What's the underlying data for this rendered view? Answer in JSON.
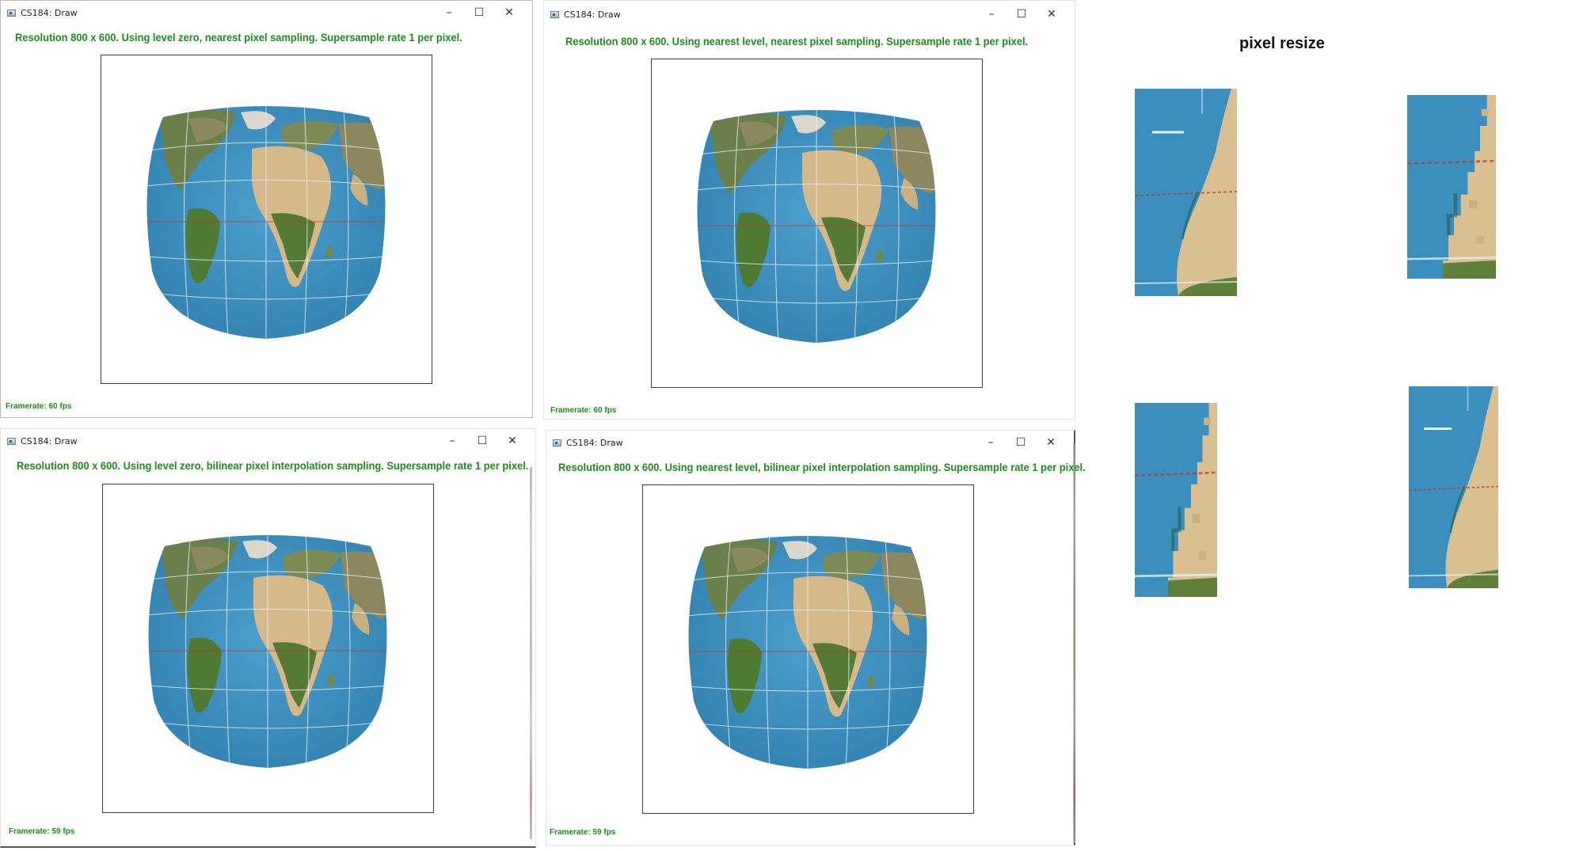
{
  "windows": [
    {
      "title": "CS184: Draw",
      "status": "Resolution 800 x 600. Using level zero, nearest pixel sampling. Supersample rate 1 per pixel.",
      "framerate": "Framerate: 60 fps"
    },
    {
      "title": "CS184: Draw",
      "status": "Resolution 800 x 600. Using nearest level, nearest pixel sampling. Supersample rate 1 per pixel.",
      "framerate": "Framerate: 60 fps"
    },
    {
      "title": "CS184: Draw",
      "status": "Resolution 800 x 600. Using level zero, bilinear pixel interpolation sampling. Supersample rate 1 per pixel.",
      "framerate": "Framerate: 59 fps"
    },
    {
      "title": "CS184: Draw",
      "status": "Resolution 800 x 600. Using nearest level, bilinear pixel interpolation sampling. Supersample rate 1 per pixel.",
      "framerate": "Framerate: 59 fps"
    }
  ],
  "window_controls": {
    "minimize": "–",
    "maximize": "☐",
    "close": "✕"
  },
  "side_panel": {
    "title": "pixel resize"
  },
  "colors": {
    "status_green": "#1e8a1e",
    "ocean": "#3a8fbf",
    "land_sand": "#d9bf92",
    "land_green": "#5f7f3a"
  }
}
